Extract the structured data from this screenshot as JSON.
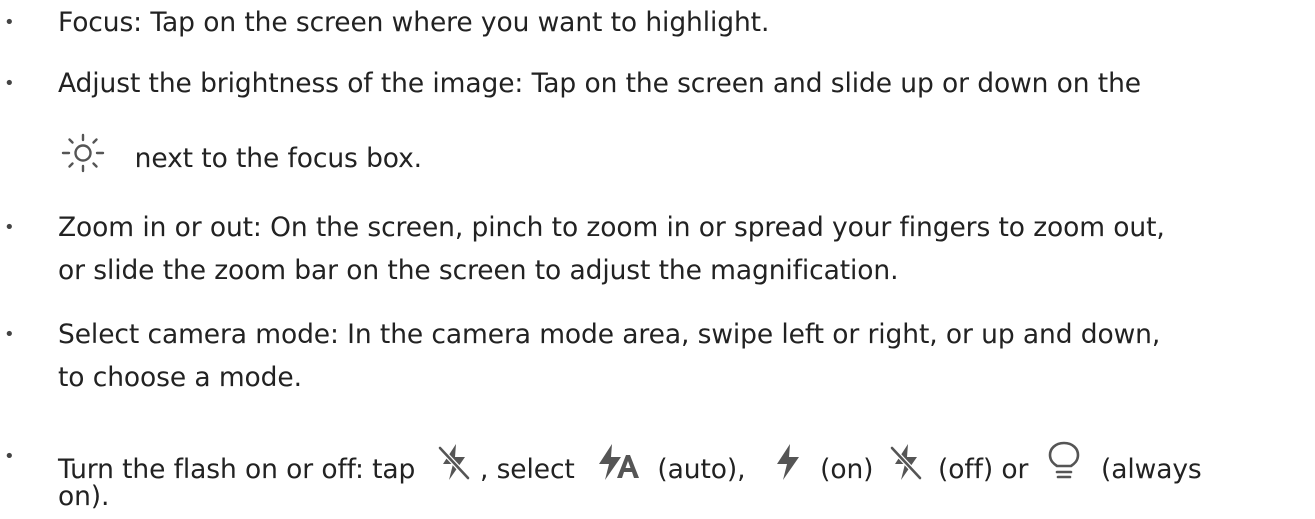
{
  "bullet_char": "•",
  "items": [
    {
      "label": "Focus",
      "lines": [
        "Focus: Tap on the screen where you want to highlight."
      ]
    },
    {
      "label": "Brightness",
      "lines": [
        "Adjust the brightness of the image: Tap on the screen and slide up or down on the",
        "next to the focus box."
      ],
      "icon": "brightness-sun-icon"
    },
    {
      "label": "Zoom",
      "lines": [
        "Zoom in or out: On the screen, pinch to zoom in or spread your fingers to zoom out,",
        "or slide the zoom bar on the screen to adjust the magnification."
      ]
    },
    {
      "label": "Camera mode",
      "lines": [
        "Select camera mode: In the camera mode area, swipe left or right, or up and down,",
        "to choose a mode."
      ]
    },
    {
      "label": "Flash",
      "lines": [
        "on)."
      ],
      "segments": [
        "Turn the flash on or off: tap",
        ", select",
        "(auto),",
        "(on)",
        "(off) or",
        "(always"
      ],
      "icons": [
        "flash-off-icon",
        "flash-auto-icon",
        "flash-on-icon",
        "flash-off-icon",
        "flash-always-on-icon"
      ]
    }
  ],
  "colors": {
    "text": "#222222",
    "icon": "#555555",
    "background": "#ffffff"
  }
}
